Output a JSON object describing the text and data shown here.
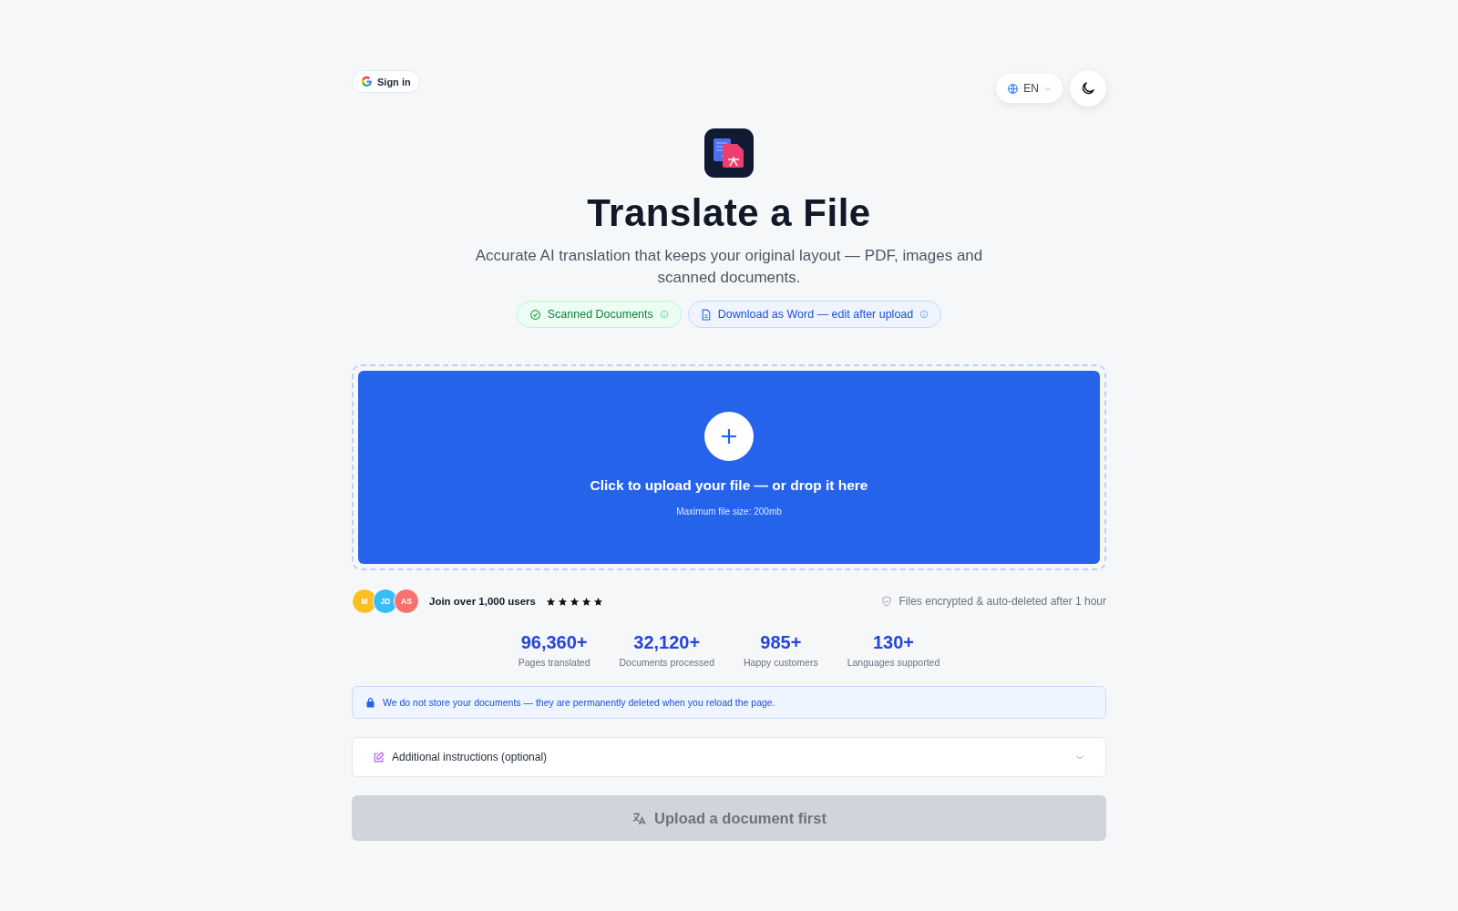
{
  "header": {
    "sign_in": "Sign in",
    "language": "EN",
    "dark_mode": false
  },
  "hero": {
    "title": "Translate a File",
    "subtitle": "Accurate AI translation that keeps your original layout — PDF, images and scanned documents.",
    "chips": [
      {
        "kind": "check",
        "label": "Scanned Documents"
      },
      {
        "kind": "document",
        "label": "Download as Word — edit after upload"
      }
    ]
  },
  "upload": {
    "label": "Click to upload your file — or drop it here",
    "hint": "Maximum file size: 200mb"
  },
  "social": {
    "avatars": [
      {
        "initials": "M",
        "color": "#fbbf24"
      },
      {
        "initials": "JD",
        "color": "#38bdf8"
      },
      {
        "initials": "AS",
        "color": "#f87171"
      }
    ],
    "text": "Join over 1,000 users",
    "stars": 5,
    "security": "Files encrypted & auto-deleted after 1 hour"
  },
  "stats": [
    {
      "value": "96,360+",
      "label": "Pages translated"
    },
    {
      "value": "32,120+",
      "label": "Documents processed"
    },
    {
      "value": "985+",
      "label": "Happy customers"
    },
    {
      "value": "130+",
      "label": "Languages supported"
    }
  ],
  "notice": "We do not store your documents — they are permanently deleted when you reload the page.",
  "instructions": {
    "label": "Additional instructions (optional)",
    "expanded": false
  },
  "submit": {
    "label": "Upload a document first",
    "disabled": true
  }
}
